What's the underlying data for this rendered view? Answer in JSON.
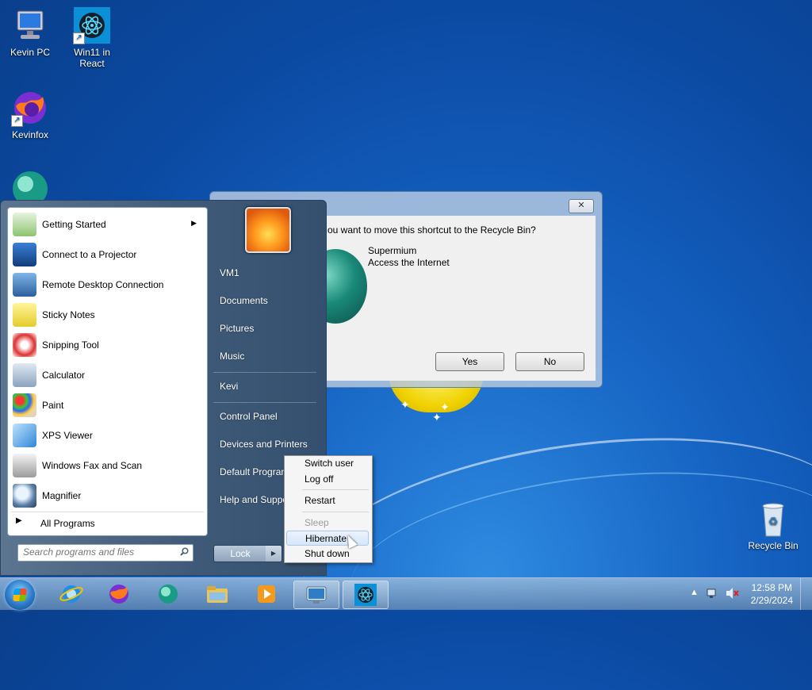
{
  "desktop": {
    "icons": [
      {
        "label": "Kevin PC"
      },
      {
        "label": "Win11 in React"
      },
      {
        "label": "Kevinfox"
      },
      {
        "label": ""
      },
      {
        "label": "Recycle Bin"
      }
    ]
  },
  "dialog": {
    "question": "ou want to move this shortcut to the Recycle Bin?",
    "item_name": "Supermium",
    "item_description": "Access the Internet",
    "yes_label": "Yes",
    "no_label": "No",
    "close_glyph": "✕"
  },
  "start_menu": {
    "programs": [
      {
        "label": "Getting Started",
        "icon": "getting-started-icon",
        "has_submenu": true
      },
      {
        "label": "Connect to a Projector",
        "icon": "projector-icon"
      },
      {
        "label": "Remote Desktop Connection",
        "icon": "remote-desktop-icon"
      },
      {
        "label": "Sticky Notes",
        "icon": "sticky-notes-icon"
      },
      {
        "label": "Snipping Tool",
        "icon": "snipping-tool-icon"
      },
      {
        "label": "Calculator",
        "icon": "calculator-icon"
      },
      {
        "label": "Paint",
        "icon": "paint-icon"
      },
      {
        "label": "XPS Viewer",
        "icon": "xps-viewer-icon"
      },
      {
        "label": "Windows Fax and Scan",
        "icon": "fax-scan-icon"
      },
      {
        "label": "Magnifier",
        "icon": "magnifier-icon"
      }
    ],
    "all_programs": "All Programs",
    "search_placeholder": "Search programs and files",
    "right_links": {
      "user": "VM1",
      "documents": "Documents",
      "pictures": "Pictures",
      "music": "Music",
      "kevi": "Kevi",
      "control_panel": "Control Panel",
      "devices": "Devices and Printers",
      "default_programs": "Default Programs",
      "help": "Help and Support"
    },
    "lock_label": "Lock",
    "lock_arrow": "▶"
  },
  "power_menu": {
    "switch_user": "Switch user",
    "log_off": "Log off",
    "restart": "Restart",
    "sleep": "Sleep",
    "hibernate": "Hibernate",
    "shut_down": "Shut down"
  },
  "taskbar": {
    "items": [
      "internet-explorer-icon",
      "firefox-icon",
      "supermium-icon",
      "file-explorer-icon",
      "media-player-icon",
      "remote-desktop-icon",
      "react-icon"
    ],
    "time": "12:58 PM",
    "date": "2/29/2024",
    "tray_arrow": "▲"
  }
}
